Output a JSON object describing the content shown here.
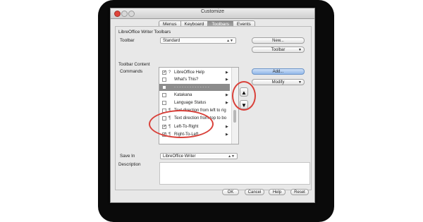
{
  "window": {
    "title": "Customize"
  },
  "tabs": [
    {
      "label": "Menus",
      "active": false
    },
    {
      "label": "Keyboard",
      "active": false
    },
    {
      "label": "Toolbars",
      "active": true
    },
    {
      "label": "Events",
      "active": false
    }
  ],
  "section": {
    "title": "LibreOffice Writer Toolbars"
  },
  "toolbar": {
    "label": "Toolbar",
    "value": "Standard",
    "new_button": "New...",
    "toolbar_button": "Toolbar"
  },
  "content": {
    "title": "Toolbar Content",
    "commands_label": "Commands"
  },
  "commands": [
    {
      "label": "LibreOffice Help",
      "checked": true,
      "icon": "help-icon",
      "submenu": true
    },
    {
      "label": "What's This?",
      "checked": false,
      "icon": "",
      "submenu": true
    },
    {
      "label": "",
      "separator": true
    },
    {
      "label": "Katakana",
      "checked": false,
      "icon": "",
      "submenu": true
    },
    {
      "label": "Language Status",
      "checked": false,
      "icon": "",
      "submenu": true
    },
    {
      "label": "Text direction from left to rig",
      "checked": false,
      "icon": "text-direction-icon",
      "submenu": false
    },
    {
      "label": "Text direction from top to bo",
      "checked": false,
      "icon": "text-direction-icon",
      "submenu": false
    },
    {
      "label": "Left-To-Right",
      "checked": true,
      "icon": "ltr-icon",
      "submenu": true
    },
    {
      "label": "Right-To-Left",
      "checked": true,
      "icon": "rtl-icon",
      "submenu": true
    }
  ],
  "side_buttons": {
    "add": "Add...",
    "modify": "Modify"
  },
  "move": {
    "up_icon": "▲",
    "down_icon": "▼"
  },
  "save": {
    "label": "Save In",
    "value": "LibreOffice Writer"
  },
  "description": {
    "label": "Description"
  },
  "footer": {
    "ok": "OK",
    "cancel": "Cancel",
    "help": "Help",
    "reset": "Reset"
  },
  "colors": {
    "annotation": "#d9413a",
    "accent": "#93b9ea"
  }
}
